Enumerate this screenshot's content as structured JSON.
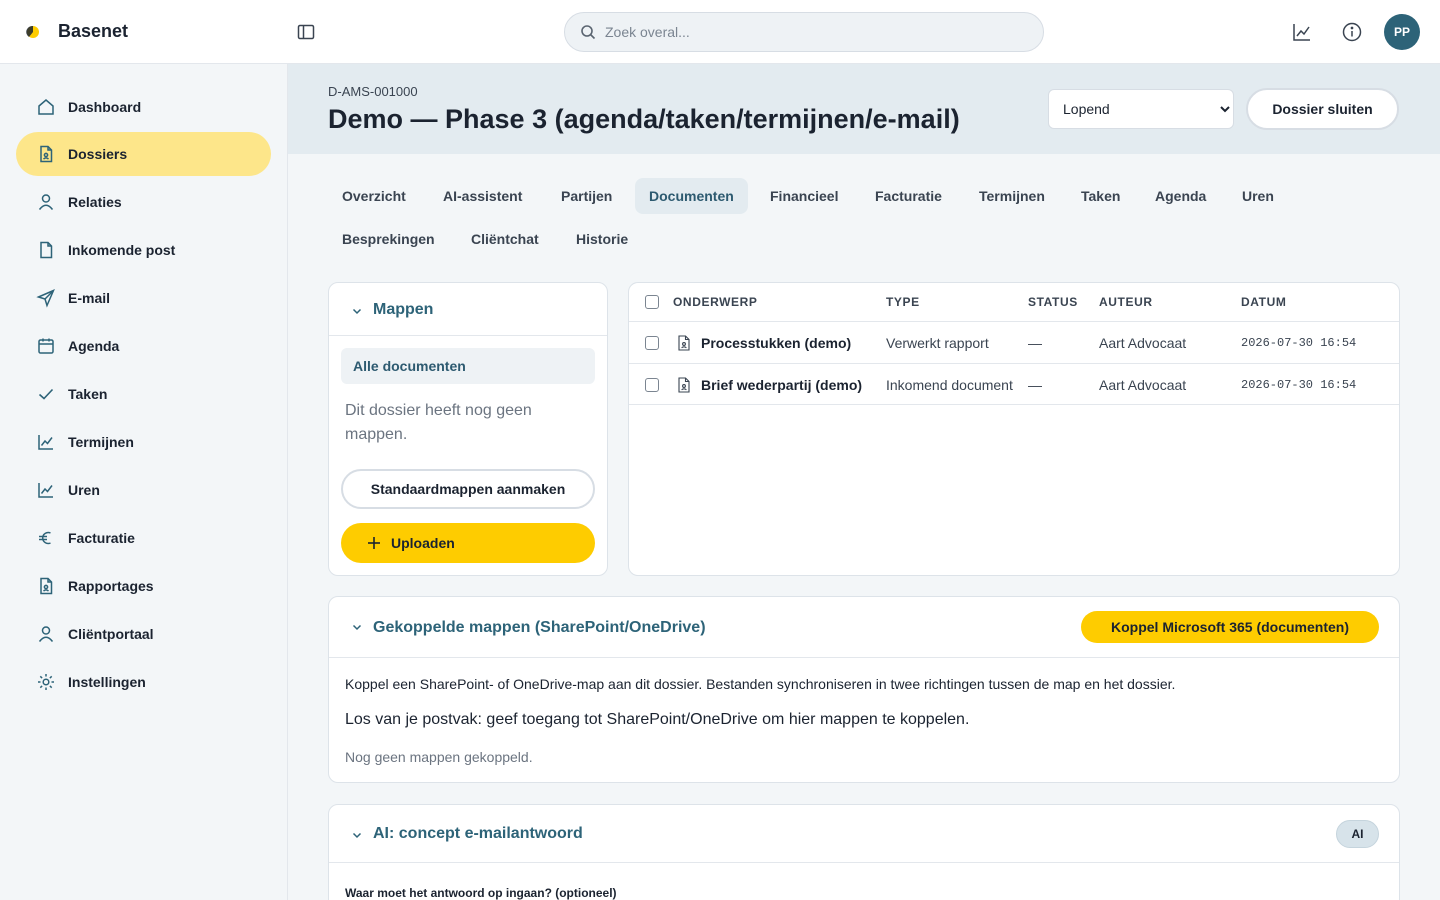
{
  "app": {
    "brand": "Basenet",
    "brand_color": "#fecc00",
    "accent": "#2d6378"
  },
  "topbar": {
    "search_placeholder": "Zoek overal...",
    "icons": [
      "sidebar-toggle-icon",
      "search-icon",
      "chart-icon",
      "info-icon"
    ],
    "avatar_initials": "PP"
  },
  "sidebar": {
    "items": [
      {
        "label": "Dashboard",
        "icon": "home-icon"
      },
      {
        "label": "Dossiers",
        "icon": "file-icon",
        "active": true
      },
      {
        "label": "Relaties",
        "icon": "user-icon"
      },
      {
        "label": "Inkomende post",
        "icon": "document-icon"
      },
      {
        "label": "E-mail",
        "icon": "send-icon"
      },
      {
        "label": "Agenda",
        "icon": "calendar-icon"
      },
      {
        "label": "Taken",
        "icon": "check-icon"
      },
      {
        "label": "Termijnen",
        "icon": "chart-icon"
      },
      {
        "label": "Uren",
        "icon": "chart-icon"
      },
      {
        "label": "Facturatie",
        "icon": "euro-icon"
      },
      {
        "label": "Rapportages",
        "icon": "file-icon"
      },
      {
        "label": "Cliëntportaal",
        "icon": "user-icon"
      },
      {
        "label": "Instellingen",
        "icon": "settings-icon"
      }
    ]
  },
  "dossier": {
    "id": "D-AMS-001000",
    "title": "Demo — Phase 3 (agenda/taken/termijnen/e-mail)",
    "status_selected": "Lopend",
    "close_label": "Dossier sluiten"
  },
  "tabs": [
    "Overzicht",
    "AI-assistent",
    "Partijen",
    "Documenten",
    "Financieel",
    "Facturatie",
    "Termijnen",
    "Taken",
    "Agenda",
    "Uren",
    "Besprekingen",
    "Cliëntchat",
    "Historie"
  ],
  "active_tab": "Documenten",
  "folders": {
    "title": "Mappen",
    "all_label": "Alle documenten",
    "empty_text": "Dit dossier heeft nog geen mappen.",
    "create_label": "Standaardmappen aanmaken",
    "upload_label": "Uploaden"
  },
  "documents": {
    "columns": [
      "ONDERWERP",
      "TYPE",
      "STATUS",
      "AUTEUR",
      "DATUM"
    ],
    "rows": [
      {
        "subject": "Processtukken (demo)",
        "type": "Verwerkt rapport",
        "status": "—",
        "author": "Aart Advocaat",
        "date": "2026-07-30 16:54"
      },
      {
        "subject": "Brief wederpartij (demo)",
        "type": "Inkomend document",
        "status": "—",
        "author": "Aart Advocaat",
        "date": "2026-07-30 16:54"
      }
    ]
  },
  "linked": {
    "title": "Gekoppelde mappen (SharePoint/OneDrive)",
    "button": "Koppel Microsoft 365 (documenten)",
    "description": "Koppel een SharePoint- of OneDrive-map aan dit dossier. Bestanden synchroniseren in twee richtingen tussen de map en het dossier.",
    "note": "Los van je postvak: geef toegang tot SharePoint/OneDrive om hier mappen te koppelen.",
    "empty": "Nog geen mappen gekoppeld."
  },
  "ai_reply": {
    "title": "AI: concept e-mailantwoord",
    "badge": "AI",
    "field_label": "Waar moet het antwoord op ingaan? (optioneel)"
  }
}
